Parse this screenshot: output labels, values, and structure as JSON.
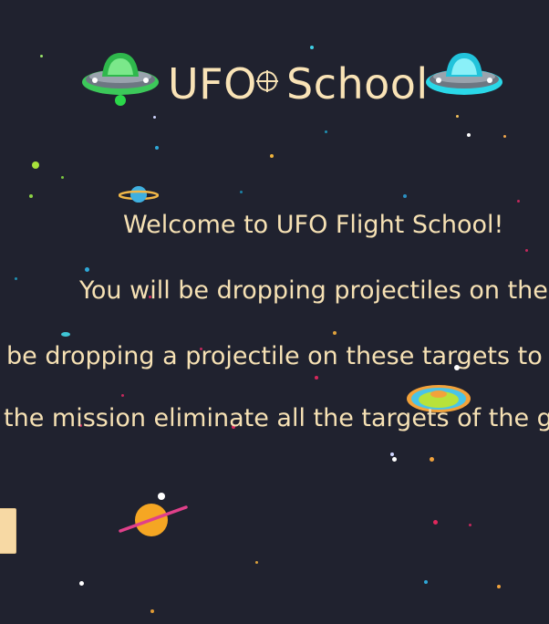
{
  "title": {
    "word1": "UFO",
    "word2": "School"
  },
  "intro": {
    "welcome": "Welcome to UFO Flight School!",
    "line1": "You will be dropping projectiles on the",
    "line2": "be dropping a projectile on these targets to e",
    "line3": "the mission eliminate all the targets of the gr"
  },
  "icons": {
    "ufo_left": "green-ufo-icon",
    "ufo_right": "cyan-ufo-icon",
    "crosshair": "crosshair-icon",
    "planets": [
      "small-blue-ringed-planet",
      "green-ringed-planet",
      "orange-ringed-planet"
    ]
  },
  "colors": {
    "background": "#20222f",
    "text": "#f6e1b4",
    "button": "#f7d9a4"
  }
}
